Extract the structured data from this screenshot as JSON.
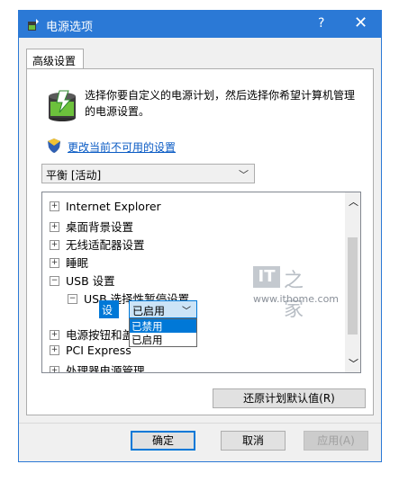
{
  "window": {
    "title": "电源选项",
    "help": "?",
    "close": "✕"
  },
  "tabs": [
    {
      "label": "高级设置"
    }
  ],
  "description": "选择你要自定义的电源计划，然后选择你希望计算机管理的电源设置。",
  "change_link": "更改当前不可用的设置",
  "plan_combo": {
    "value": "平衡 [活动]"
  },
  "tree": {
    "items": [
      {
        "symbol": "⊞",
        "label": "Internet Explorer"
      },
      {
        "symbol": "⊞",
        "label": "桌面背景设置"
      },
      {
        "symbol": "⊞",
        "label": "无线适配器设置"
      },
      {
        "symbol": "⊞",
        "label": "睡眠"
      },
      {
        "symbol": "⊟",
        "label": "USB 设置"
      },
      {
        "symbol": "⊟",
        "label": "USB 选择性暂停设置"
      },
      {
        "symbol": "⊞",
        "label": "电源按钮和盖"
      },
      {
        "symbol": "⊞",
        "label": "PCI Express"
      },
      {
        "symbol": "⊞",
        "label": "处理器电源管理"
      }
    ],
    "setting_label": "设置:",
    "setting_value": "已启用",
    "dropdown_options": [
      "已禁用",
      "已启用"
    ],
    "dropdown_selected": "已禁用"
  },
  "watermark": {
    "logo": "IT",
    "chars": "之家",
    "url": "www.ithome.com"
  },
  "buttons": {
    "reset": "还原计划默认值(R)",
    "ok": "确定",
    "cancel": "取消",
    "apply": "应用(A)"
  },
  "colors": {
    "titlebar": "#2b79d6",
    "selection": "#0078d7",
    "link": "#0a5bc4"
  }
}
